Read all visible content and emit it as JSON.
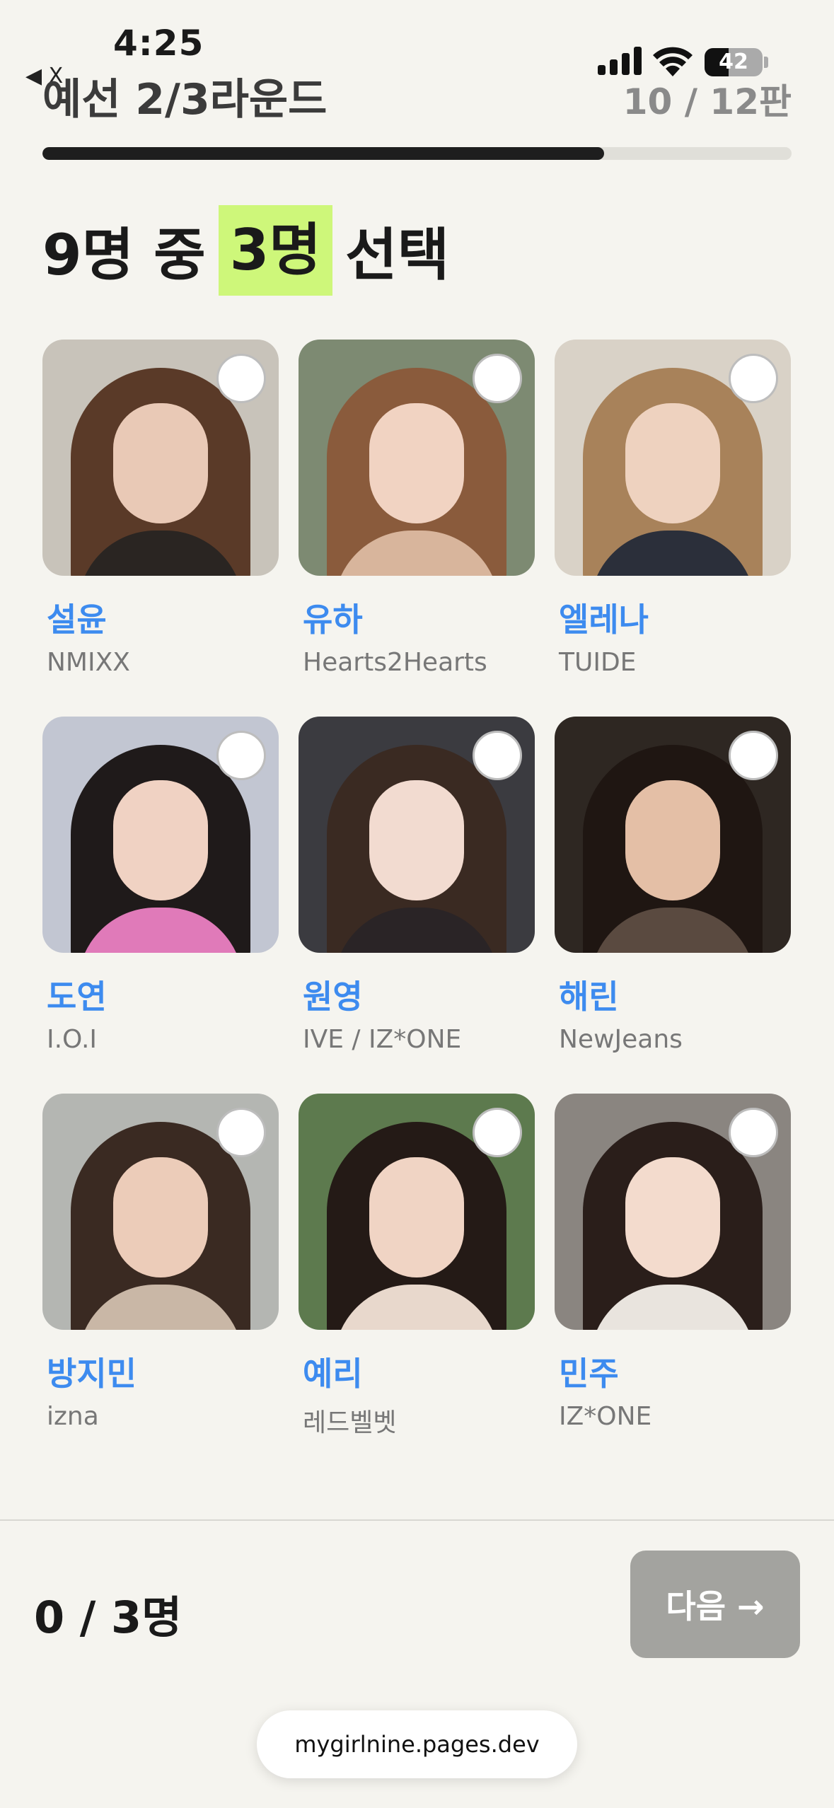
{
  "status_bar": {
    "time": "4:25",
    "back_label": "◀ X",
    "battery": "42",
    "battery_level": 0.42
  },
  "header": {
    "round_title": "예선 2/3라운드",
    "counter": "10 / 12판",
    "progress": 0.75
  },
  "headline": {
    "prefix": "9명 중",
    "highlight": "3명",
    "suffix": "선택"
  },
  "cards": [
    {
      "name": "설윤",
      "group": "NMIXX",
      "bg": "#c8c3ba",
      "hair": "#5a3a28",
      "face": "#e9c9b6",
      "body": "#2a2522"
    },
    {
      "name": "유하",
      "group": "Hearts2Hearts",
      "bg": "#7d8a72",
      "hair": "#8a5b3c",
      "face": "#f1d3c2",
      "body": "#d8b59c"
    },
    {
      "name": "엘레나",
      "group": "TUIDE",
      "bg": "#d9d2c7",
      "hair": "#a8825a",
      "face": "#eed2bf",
      "body": "#2b2f3a"
    },
    {
      "name": "도연",
      "group": "I.O.I",
      "bg": "#c2c6d2",
      "hair": "#1f1a1a",
      "face": "#f0d2c3",
      "body": "#e07ab9"
    },
    {
      "name": "원영",
      "group": "IVE / IZ*ONE",
      "bg": "#3b3b40",
      "hair": "#3a2a22",
      "face": "#f2dbd0",
      "body": "#2a2426"
    },
    {
      "name": "해린",
      "group": "NewJeans",
      "bg": "#2e2722",
      "hair": "#1f1612",
      "face": "#e4bfa6",
      "body": "#5a4a40"
    },
    {
      "name": "방지민",
      "group": "izna",
      "bg": "#b4b6b2",
      "hair": "#3a2a22",
      "face": "#ecccb9",
      "body": "#c9b7a6"
    },
    {
      "name": "예리",
      "group": "레드벨벳",
      "bg": "#5d7a4e",
      "hair": "#241a16",
      "face": "#f0d4c4",
      "body": "#e8d8cc"
    },
    {
      "name": "민주",
      "group": "IZ*ONE",
      "bg": "#8a8580",
      "hair": "#2a1e1a",
      "face": "#f3dbcd",
      "body": "#e9e4de"
    }
  ],
  "footer": {
    "count": "0 / 3명",
    "next_label": "다음 →"
  },
  "browser": {
    "url": "mygirlnine.pages.dev"
  }
}
